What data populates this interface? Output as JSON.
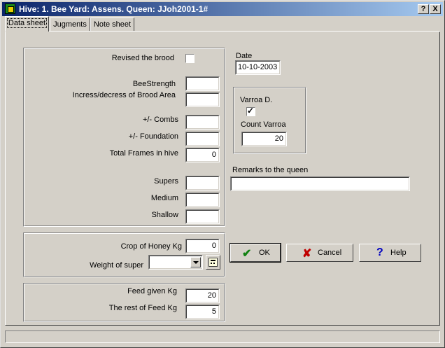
{
  "window": {
    "title": "Hive: 1. Bee Yard: Assens. Queen: JJoh2001-1#",
    "help_button": "?",
    "close_button": "X"
  },
  "tabs": [
    {
      "label": "Data sheet"
    },
    {
      "label": "Jugments"
    },
    {
      "label": "Note sheet"
    }
  ],
  "brood": {
    "revised_label": "Revised the brood",
    "bee_strength_label": "BeeStrength",
    "bee_strength_value": "",
    "brood_area_label": "Incress/decress of Brood Area",
    "brood_area_value": "",
    "combs_label": "+/- Combs",
    "combs_value": "",
    "foundation_label": "+/- Foundation",
    "foundation_value": "",
    "total_frames_label": "Total Frames in hive",
    "total_frames_value": "0",
    "supers_label": "Supers",
    "supers_value": "",
    "medium_label": "Medium",
    "medium_value": "",
    "shallow_label": "Shallow",
    "shallow_value": ""
  },
  "honey": {
    "crop_label": "Crop of Honey Kg",
    "crop_value": "0",
    "weight_label": "Weight of super",
    "weight_value": ""
  },
  "feed": {
    "feed_given_label": "Feed given Kg",
    "feed_given_value": "20",
    "rest_label": "The rest of Feed Kg",
    "rest_value": "5"
  },
  "date": {
    "label": "Date",
    "value": "10-10-2003"
  },
  "varroa": {
    "label": "Varroa D.",
    "checked": true,
    "count_label": "Count Varroa",
    "count_value": "20"
  },
  "remarks": {
    "label": "Remarks to the queen",
    "value": ""
  },
  "buttons": {
    "ok": "OK",
    "cancel": "Cancel",
    "help": "Help"
  },
  "colors": {
    "ok_icon": "#108010",
    "cancel_icon": "#c00000",
    "help_icon": "#0000c0"
  }
}
